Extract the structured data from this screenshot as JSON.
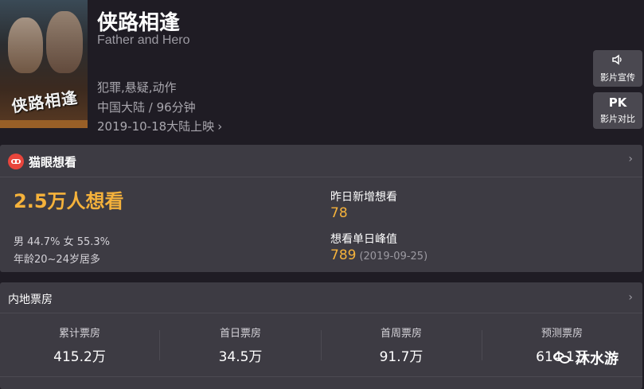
{
  "movie": {
    "poster_title": "侠路相逢",
    "title_cn": "侠路相逢",
    "title_en": "Father and Hero",
    "genre": "犯罪,悬疑,动作",
    "region_runtime": "中国大陆 / 96分钟",
    "release": "2019-10-18大陆上映"
  },
  "side_buttons": {
    "promo": {
      "icon": "speaker-icon",
      "label": "影片宣传"
    },
    "pk": {
      "icon": "PK",
      "label": "影片对比"
    }
  },
  "want": {
    "title": "猫眼想看",
    "total": "2.5万人想看",
    "gender": "男 44.7% 女 55.3%",
    "age": "年龄20~24岁居多",
    "yesterday_label": "昨日新增想看",
    "yesterday_value": "78",
    "peak_label": "想看单日峰值",
    "peak_value": "789",
    "peak_date": "(2019-09-25)"
  },
  "box_office": {
    "title": "内地票房",
    "stats": [
      {
        "label": "累计票房",
        "value": "415.2万"
      },
      {
        "label": "首日票房",
        "value": "34.5万"
      },
      {
        "label": "首周票房",
        "value": "91.7万"
      },
      {
        "label": "预测票房",
        "value": "614.1万"
      }
    ]
  },
  "watermark": {
    "text": "沐水游"
  },
  "colors": {
    "background": "#1f1c24",
    "card": "#3d3b43",
    "accent": "#f5b23b",
    "brand": "#e8453c"
  }
}
